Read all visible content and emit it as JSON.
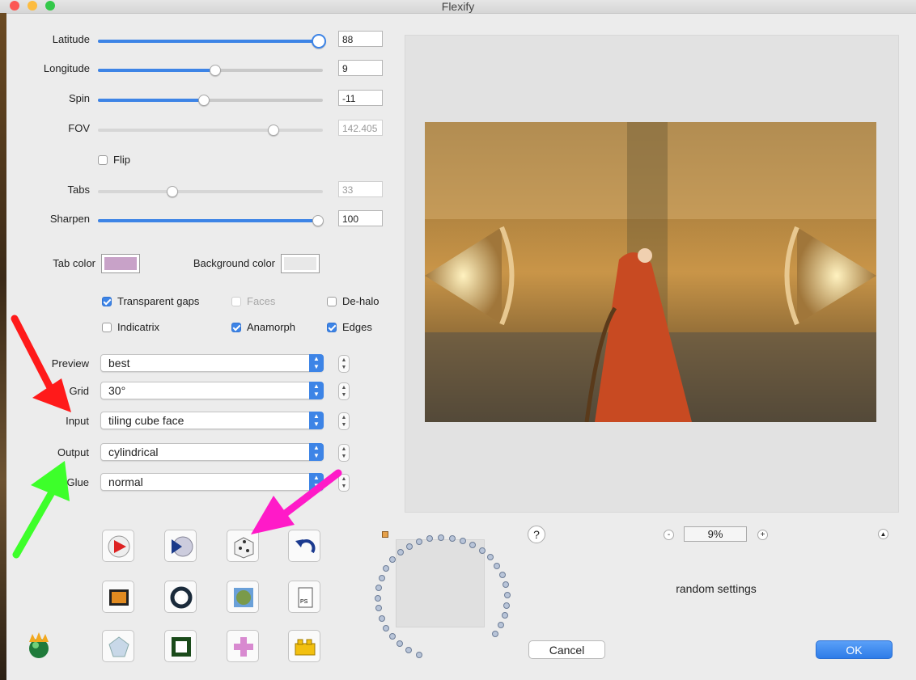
{
  "window": {
    "title": "Flexify"
  },
  "colors": {
    "accent": "#3d84e6",
    "tab_color": "#c8a2c8",
    "background_color": "#e8e8e8",
    "arrow_red": "#ff1a1a",
    "arrow_green": "#3dff2a",
    "arrow_magenta": "#ff1ac8"
  },
  "sliders": [
    {
      "label": "Latitude",
      "value": "88",
      "level": 1.0,
      "enabled": true
    },
    {
      "label": "Longitude",
      "value": "9",
      "level": 0.52,
      "enabled": true
    },
    {
      "label": "Spin",
      "value": "-11",
      "level": 0.47,
      "enabled": true
    },
    {
      "label": "FOV",
      "value": "142.405",
      "level": 0.78,
      "enabled": false
    },
    {
      "label": "Tabs",
      "value": "33",
      "level": 0.33,
      "enabled": false
    },
    {
      "label": "Sharpen",
      "value": "100",
      "level": 1.0,
      "enabled": true
    }
  ],
  "flip": {
    "label": "Flip",
    "checked": false
  },
  "tab_color_label": "Tab color",
  "background_color_label": "Background color",
  "checkboxes": [
    {
      "label": "Transparent gaps",
      "checked": true,
      "enabled": true
    },
    {
      "label": "Faces",
      "checked": false,
      "enabled": false
    },
    {
      "label": "De-halo",
      "checked": false,
      "enabled": true
    },
    {
      "label": "Indicatrix",
      "checked": false,
      "enabled": true
    },
    {
      "label": "Anamorph",
      "checked": true,
      "enabled": true
    },
    {
      "label": "Edges",
      "checked": true,
      "enabled": true
    }
  ],
  "dropdowns": [
    {
      "label": "Preview",
      "value": "best"
    },
    {
      "label": "Grid",
      "value": "30°"
    },
    {
      "label": "Input",
      "value": "tiling cube face"
    },
    {
      "label": "Output",
      "value": "cylindrical"
    },
    {
      "label": "Glue",
      "value": "normal"
    }
  ],
  "icon_buttons": [
    "play-triangle-icon",
    "fast-forward-disc-icon",
    "dice-icon",
    "undo-arrow-icon",
    "image-frame-icon",
    "ring-icon",
    "globe-image-icon",
    "document-icon",
    "diamond-icon",
    "square-frame-icon",
    "cross-icon",
    "lego-brick-icon"
  ],
  "app_logo": "flame-ball-icon",
  "zoom": {
    "value": "9%",
    "minus": "-",
    "plus": "+"
  },
  "help": {
    "label": "?"
  },
  "hint_text": "random settings",
  "buttons": {
    "cancel": "Cancel",
    "ok": "OK"
  }
}
